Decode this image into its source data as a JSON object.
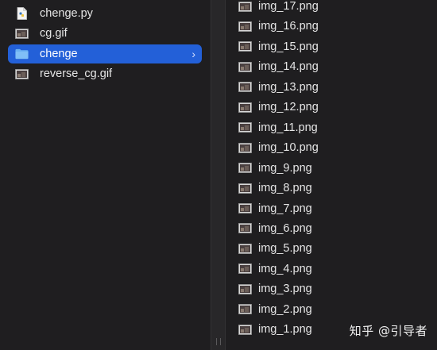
{
  "left_column": {
    "items": [
      {
        "label": "chenge.py",
        "icon": "python-file-icon"
      },
      {
        "label": "cg.gif",
        "icon": "image-file-icon"
      },
      {
        "label": "chenge",
        "icon": "folder-icon",
        "selected": true
      },
      {
        "label": "reverse_cg.gif",
        "icon": "image-file-icon"
      }
    ],
    "chevron": "›"
  },
  "right_column": {
    "files": [
      "img_17.png",
      "img_16.png",
      "img_15.png",
      "img_14.png",
      "img_13.png",
      "img_12.png",
      "img_11.png",
      "img_10.png",
      "img_9.png",
      "img_8.png",
      "img_7.png",
      "img_6.png",
      "img_5.png",
      "img_4.png",
      "img_3.png",
      "img_2.png",
      "img_1.png"
    ]
  },
  "watermark": "知乎 @引导者",
  "colors": {
    "background": "#1f1e20",
    "selection": "#2360d8",
    "folder": "#5fa8f0",
    "text": "#e6e6e6"
  }
}
